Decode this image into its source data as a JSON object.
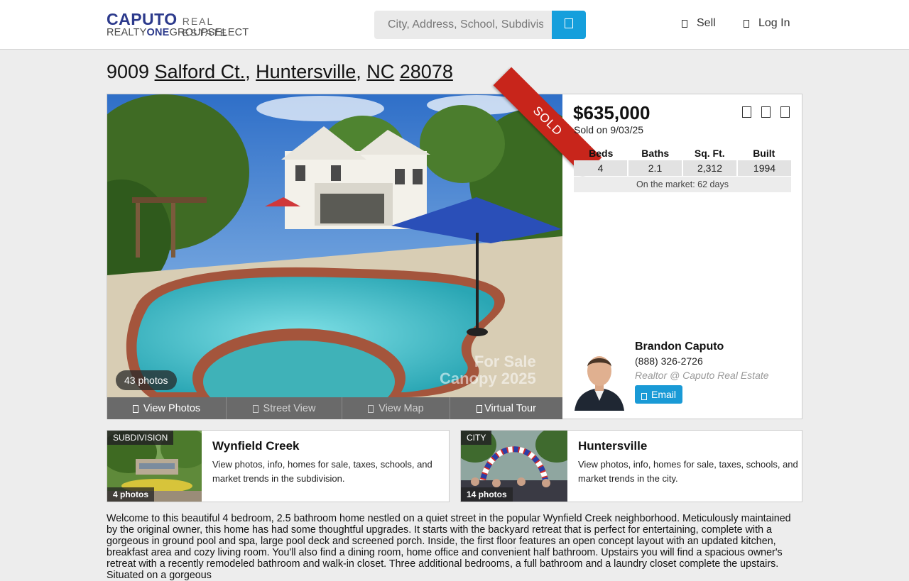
{
  "header": {
    "logo_brand": "CAPUTO",
    "logo_subbrand": "REAL ESTATE",
    "logo_line2_a": "REALTY",
    "logo_line2_b": "ONE",
    "logo_line2_c": "GROUPSELECT",
    "search_placeholder": "City, Address, School, Subdivision",
    "nav": {
      "sell": "Sell",
      "login": "Log In"
    }
  },
  "listing": {
    "address": {
      "street_num": "9009",
      "street": "Salford Ct.",
      "city": "Huntersville",
      "state": "NC",
      "zip": "28078"
    },
    "sold_ribbon": "SOLD",
    "photo_count": "43 photos",
    "watermark": "For Sale\nCanopy 2025",
    "actions": {
      "view_photos": "View Photos",
      "street_view": "Street View",
      "view_map": "View Map",
      "virtual_tour": "Virtual Tour"
    },
    "price": "$635,000",
    "sold_date": "Sold on 9/03/25",
    "stats": {
      "headers": [
        "Beds",
        "Baths",
        "Sq. Ft.",
        "Built"
      ],
      "values": [
        "4",
        "2.1",
        "2,312",
        "1994"
      ],
      "market": "On the market: 62 days"
    },
    "agent": {
      "name": "Brandon Caputo",
      "phone": "(888) 326-2726",
      "title": "Realtor @ Caputo Real Estate",
      "email_label": "Email"
    }
  },
  "subdivision_card": {
    "tag": "SUBDIVISION",
    "count": "4 photos",
    "title": "Wynfield Creek",
    "desc": "View photos, info, homes for sale, taxes, schools, and market trends in the subdivision."
  },
  "city_card": {
    "tag": "CITY",
    "count": "14 photos",
    "title": "Huntersville",
    "desc": "View photos, info, homes for sale, taxes, schools, and market trends in the city."
  },
  "description": "Welcome to this beautiful 4 bedroom, 2.5 bathroom home nestled on a quiet street in the popular Wynfield Creek neighborhood. Meticulously maintained by the original owner, this home has had some thoughtful upgrades. It starts with the backyard retreat that is perfect for entertaining, complete with a gorgeous in ground pool and spa, large pool deck and screened porch. Inside, the first floor features an open concept layout with an updated kitchen, breakfast area and cozy living room. You'll also find a dining room, home office and convenient half bathroom. Upstairs you will find a spacious owner's retreat with a recently remodeled bathroom and walk-in closet. Three additional bedrooms, a full bathroom and a laundry closet complete the upstairs. Situated on a gorgeous"
}
